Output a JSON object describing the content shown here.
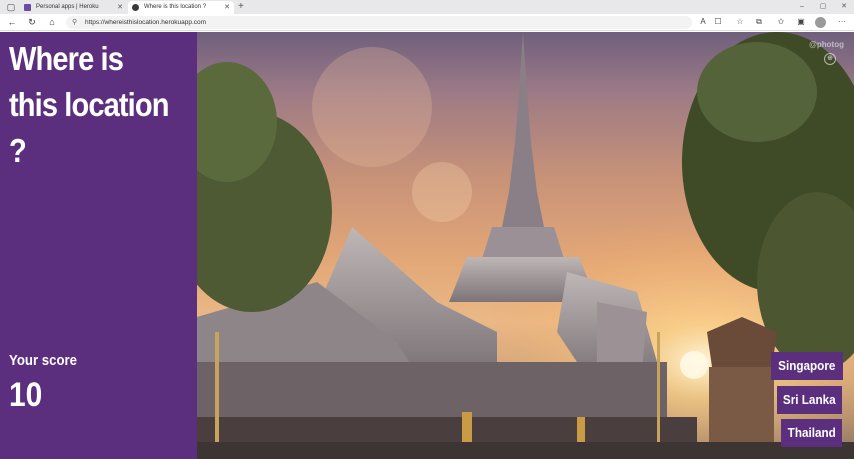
{
  "browser": {
    "tabs": [
      {
        "title": "Personal apps | Heroku",
        "active": false
      },
      {
        "title": "Where is this location ?",
        "active": true
      }
    ],
    "url": "https://whereisthislocation.herokuapp.com",
    "icons": {
      "tab_actions": "tab-actions-icon",
      "new_tab": "+",
      "minimize": "–",
      "maximize": "▢",
      "close": "✕",
      "tab_close": "✕",
      "back": "←",
      "refresh": "↻",
      "home": "⌂",
      "lock": "🔒",
      "read_aloud": "A",
      "immersive": "☐",
      "collections": "☆",
      "extensions": "⧉",
      "favorites": "✩",
      "split": "▣",
      "more": "···"
    }
  },
  "app": {
    "title": "Where is this location ?",
    "score_label": "Your score",
    "score": "10",
    "photo_credit": "@photog",
    "answers": [
      "Singapore",
      "Sri Lanka",
      "Thailand"
    ],
    "accent_color": "#5b2f7e"
  }
}
